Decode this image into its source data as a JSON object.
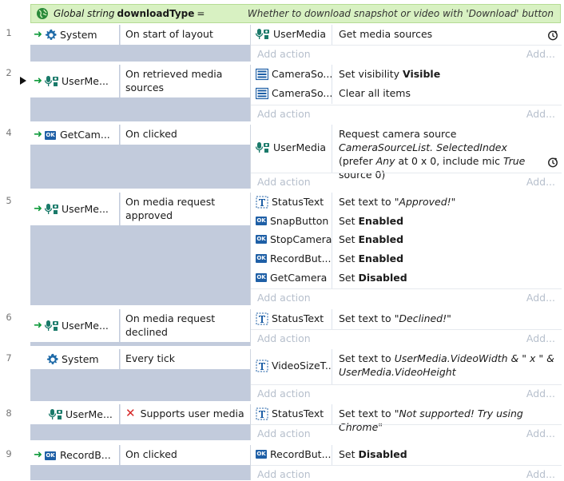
{
  "global_var": {
    "prefix": "Global string",
    "name": "downloadType",
    "equals": "=",
    "comment": "Whether to download snapshot or video with 'Download' button"
  },
  "add_action": "Add action",
  "add_more": "Add...",
  "events": [
    {
      "num": "1",
      "obj": "System",
      "cond": "On start of layout",
      "actions": [
        {
          "obj": "UserMedia",
          "text": "Get media sources"
        }
      ]
    },
    {
      "num": "2",
      "obj": "UserMe...",
      "cond": "On retrieved media sources",
      "actions": [
        {
          "obj": "CameraSo...",
          "text_a": "Set visibility",
          "text_b": "Visible"
        },
        {
          "obj": "CameraSo...",
          "text": "Clear all items"
        }
      ]
    },
    {
      "num": "4",
      "obj": "GetCam...",
      "cond": "On clicked",
      "actions": [
        {
          "obj": "UserMedia",
          "t1": "Request camera source",
          "t2": "CameraSourceList.",
          "t3": "SelectedIndex",
          "t4": "(prefer",
          "t5": "Any",
          "t6": "at 0 x 0, include mic",
          "t7": "True",
          "t8": "source 0)"
        }
      ]
    },
    {
      "num": "5",
      "obj": "UserMe...",
      "cond": "On media request approved",
      "actions": [
        {
          "obj": "StatusText",
          "text_a": "Set text to",
          "text_b": "\"Approved!\""
        },
        {
          "obj": "SnapButton",
          "text_a": "Set",
          "text_b": "Enabled"
        },
        {
          "obj": "StopCamera",
          "text_a": "Set",
          "text_b": "Enabled"
        },
        {
          "obj": "RecordBut...",
          "text_a": "Set",
          "text_b": "Enabled"
        },
        {
          "obj": "GetCamera",
          "text_a": "Set",
          "text_b": "Disabled"
        }
      ]
    },
    {
      "num": "6",
      "obj": "UserMe...",
      "cond": "On media request declined",
      "actions": [
        {
          "obj": "StatusText",
          "text_a": "Set text to",
          "text_b": "\"Declined!\""
        }
      ]
    },
    {
      "num": "7",
      "obj": "System",
      "cond": "Every tick",
      "actions": [
        {
          "obj": "VideoSizeT...",
          "text_a": "Set text to",
          "text_b": "UserMedia.VideoWidth & \" x \" &",
          "text_c": "UserMedia.VideoHeight"
        }
      ]
    },
    {
      "num": "8",
      "obj": "UserMe...",
      "cond": "Supports user media",
      "actions": [
        {
          "obj": "StatusText",
          "text_a": "Set text to",
          "text_b": "\"Not supported! Try using Chrome\""
        }
      ]
    },
    {
      "num": "9",
      "obj": "RecordB...",
      "cond": "On clicked",
      "actions": [
        {
          "obj": "RecordBut...",
          "text_a": "Set",
          "text_b": "Disabled"
        }
      ]
    }
  ],
  "icons": {
    "trigger": "trigger-arrow-icon",
    "system": "gear-icon",
    "usermedia": "usermedia-icon",
    "button": "ok-button-icon",
    "sprite": "sprite-icon",
    "text": "text-object-icon",
    "await": "await-icon",
    "invert": "invert-x-icon",
    "globe": "globe-icon"
  },
  "colors": {
    "event_bg": "#c2cbdc",
    "global_bg": "#d8f1c2",
    "trigger_green": "#0e9a3a",
    "add_text": "#b6bfcc",
    "button_icon": "#1e5fa6"
  }
}
